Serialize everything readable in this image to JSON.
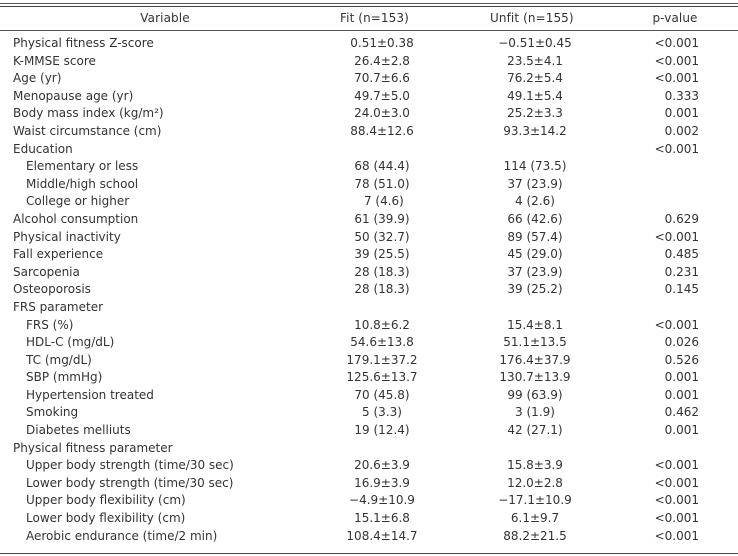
{
  "table": {
    "headers": {
      "variable": "Variable",
      "fit": "Fit (n=153)",
      "unfit": "Unfit (n=155)",
      "pvalue": "p-value"
    },
    "rows": [
      {
        "variable": "Physical fitness Z-score",
        "fit": "0.51±0.38",
        "unfit": "−0.51±0.45",
        "p": "<0.001",
        "indent": false
      },
      {
        "variable": "K-MMSE score",
        "fit": "26.4±2.8",
        "unfit": "23.5±4.1",
        "p": "<0.001",
        "indent": false
      },
      {
        "variable": "Age (yr)",
        "fit": "70.7±6.6",
        "unfit": "76.2±5.4",
        "p": "<0.001",
        "indent": false
      },
      {
        "variable": "Menopause age (yr)",
        "fit": "49.7±5.0",
        "unfit": "49.1±5.4",
        "p": "0.333",
        "indent": false
      },
      {
        "variable": "Body mass index (kg/m²)",
        "fit": "24.0±3.0",
        "unfit": "25.2±3.3",
        "p": "0.001",
        "indent": false
      },
      {
        "variable": "Waist circumstance (cm)",
        "fit": "88.4±12.6",
        "unfit": "93.3±14.2",
        "p": "0.002",
        "indent": false
      },
      {
        "variable": "Education",
        "fit": "",
        "unfit": "",
        "p": "<0.001",
        "indent": false
      },
      {
        "variable": "Elementary or less",
        "fit": "68 (44.4)",
        "unfit": "114 (73.5)",
        "p": "",
        "indent": true
      },
      {
        "variable": "Middle/high school",
        "fit": "78 (51.0)",
        "unfit": "37 (23.9)",
        "p": "",
        "indent": true
      },
      {
        "variable": "College or higher",
        "fit": " 7 (4.6)",
        "unfit": "4 (2.6)",
        "p": "",
        "indent": true
      },
      {
        "variable": "Alcohol consumption",
        "fit": "61 (39.9)",
        "unfit": "66 (42.6)",
        "p": "0.629",
        "indent": false
      },
      {
        "variable": "Physical inactivity",
        "fit": "50 (32.7)",
        "unfit": "89 (57.4)",
        "p": "<0.001",
        "indent": false
      },
      {
        "variable": "Fall experience",
        "fit": "39 (25.5)",
        "unfit": "45 (29.0)",
        "p": "0.485",
        "indent": false
      },
      {
        "variable": "Sarcopenia",
        "fit": "28 (18.3)",
        "unfit": "37 (23.9)",
        "p": "0.231",
        "indent": false
      },
      {
        "variable": "Osteoporosis",
        "fit": "28 (18.3)",
        "unfit": "39 (25.2)",
        "p": "0.145",
        "indent": false
      },
      {
        "variable": "FRS parameter",
        "fit": "",
        "unfit": "",
        "p": "",
        "indent": false
      },
      {
        "variable": "FRS (%)",
        "fit": "10.8±6.2",
        "unfit": "15.4±8.1",
        "p": "<0.001",
        "indent": true
      },
      {
        "variable": "HDL-C (mg/dL)",
        "fit": "54.6±13.8",
        "unfit": "51.1±13.5",
        "p": "0.026",
        "indent": true
      },
      {
        "variable": "TC (mg/dL)",
        "fit": "179.1±37.2",
        "unfit": "176.4±37.9",
        "p": "0.526",
        "indent": true
      },
      {
        "variable": "SBP (mmHg)",
        "fit": "125.6±13.7",
        "unfit": "130.7±13.9",
        "p": "0.001",
        "indent": true
      },
      {
        "variable": "Hypertension treated",
        "fit": "70 (45.8)",
        "unfit": "99 (63.9)",
        "p": "0.001",
        "indent": true
      },
      {
        "variable": "Smoking",
        "fit": "5 (3.3)",
        "unfit": "3 (1.9)",
        "p": "0.462",
        "indent": true
      },
      {
        "variable": "Diabetes melliuts",
        "fit": "19 (12.4)",
        "unfit": "42 (27.1)",
        "p": "0.001",
        "indent": true
      },
      {
        "variable": "Physical fitness parameter",
        "fit": "",
        "unfit": "",
        "p": "",
        "indent": false
      },
      {
        "variable": "Upper body strength (time/30 sec)",
        "fit": "20.6±3.9",
        "unfit": "15.8±3.9",
        "p": "<0.001",
        "indent": true
      },
      {
        "variable": "Lower body strength (time/30 sec)",
        "fit": "16.9±3.9",
        "unfit": "12.0±2.8",
        "p": "<0.001",
        "indent": true
      },
      {
        "variable": "Upper body flexibility (cm)",
        "fit": "−4.9±10.9",
        "unfit": "−17.1±10.9",
        "p": "<0.001",
        "indent": true
      },
      {
        "variable": "Lower body flexibility (cm)",
        "fit": "15.1±6.8",
        "unfit": "6.1±9.7",
        "p": "<0.001",
        "indent": true
      },
      {
        "variable": "Aerobic endurance (time/2 min)",
        "fit": "108.4±14.7",
        "unfit": "88.2±21.5",
        "p": "<0.001",
        "indent": true
      }
    ]
  }
}
